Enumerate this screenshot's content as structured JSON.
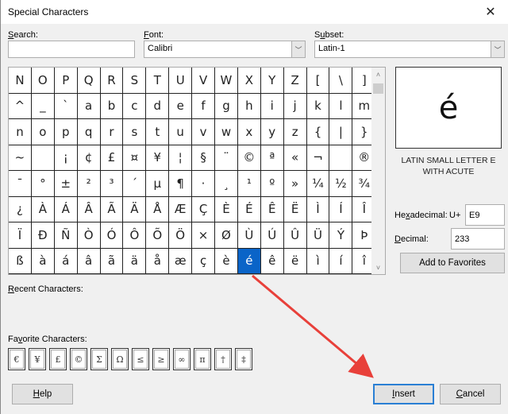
{
  "window": {
    "title": "Special Characters",
    "close_icon": "✕"
  },
  "search": {
    "label_accel": "S",
    "label_rest": "earch:",
    "value": "",
    "placeholder": ""
  },
  "font": {
    "label_accel": "F",
    "label_rest": "ont:",
    "value": "Calibri"
  },
  "subset": {
    "label_pre": "S",
    "label_accel": "u",
    "label_rest": "bset:",
    "value": "Latin-1"
  },
  "grid": {
    "rows": [
      [
        "N",
        "O",
        "P",
        "Q",
        "R",
        "S",
        "T",
        "U",
        "V",
        "W",
        "X",
        "Y",
        "Z",
        "[",
        "\\",
        "]"
      ],
      [
        "^",
        "_",
        "`",
        "a",
        "b",
        "c",
        "d",
        "e",
        "f",
        "g",
        "h",
        "i",
        "j",
        "k",
        "l",
        "m"
      ],
      [
        "n",
        "o",
        "p",
        "q",
        "r",
        "s",
        "t",
        "u",
        "v",
        "w",
        "x",
        "y",
        "z",
        "{",
        "|",
        "}"
      ],
      [
        "~",
        " ",
        "¡",
        "¢",
        "£",
        "¤",
        "¥",
        "¦",
        "§",
        "¨",
        "©",
        "ª",
        "«",
        "¬",
        "­",
        "®"
      ],
      [
        "¯",
        "°",
        "±",
        "²",
        "³",
        "´",
        "µ",
        "¶",
        "·",
        "¸",
        "¹",
        "º",
        "»",
        "¼",
        "½",
        "¾"
      ],
      [
        "¿",
        "À",
        "Á",
        "Â",
        "Ã",
        "Ä",
        "Å",
        "Æ",
        "Ç",
        "È",
        "É",
        "Ê",
        "Ë",
        "Ì",
        "Í",
        "Î"
      ],
      [
        "Ï",
        "Ð",
        "Ñ",
        "Ò",
        "Ó",
        "Ô",
        "Õ",
        "Ö",
        "×",
        "Ø",
        "Ù",
        "Ú",
        "Û",
        "Ü",
        "Ý",
        "Þ"
      ],
      [
        "ß",
        "à",
        "á",
        "â",
        "ã",
        "ä",
        "å",
        "æ",
        "ç",
        "è",
        "é",
        "ê",
        "ë",
        "ì",
        "í",
        "î"
      ]
    ],
    "selected": "é",
    "scroll_up_icon": "˄",
    "scroll_down_icon": "˅"
  },
  "preview": {
    "char": "é",
    "name": "LATIN SMALL LETTER E WITH ACUTE"
  },
  "hex": {
    "label_pre": "He",
    "label_accel": "x",
    "label_rest": "adecimal:",
    "prefix": "U+",
    "value": "E9"
  },
  "decimal": {
    "label_accel": "D",
    "label_rest": "ecimal:",
    "value": "233"
  },
  "add_favorites_label": "Add to Favorites",
  "recent": {
    "label_accel": "R",
    "label_rest": "ecent Characters:",
    "items": []
  },
  "favorites": {
    "label_pre": "Fa",
    "label_accel": "v",
    "label_rest": "orite Characters:",
    "items": [
      "€",
      "¥",
      "£",
      "©",
      "Σ",
      "Ω",
      "≤",
      "≥",
      "∞",
      "π",
      "†",
      "‡"
    ]
  },
  "buttons": {
    "help_accel": "H",
    "help_rest": "elp",
    "insert_accel": "I",
    "insert_rest": "nsert",
    "cancel_accel": "C",
    "cancel_rest": "ancel"
  },
  "annotation": {
    "arrow_color": "#e8403a"
  }
}
